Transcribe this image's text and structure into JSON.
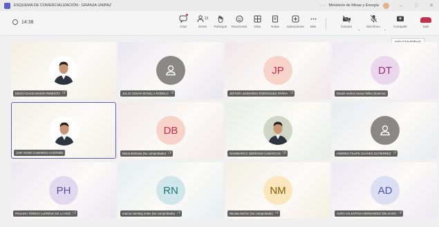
{
  "window": {
    "title": "ESQUEMA DE COMERCIALIZACIÓN - GRANJA UNIPAZ",
    "more": "···",
    "organization": "Ministerio de Minas y Energía",
    "minimize": "–",
    "maximize": "□",
    "close": "✕"
  },
  "toolbar": {
    "timer": "14:38",
    "participants_count": "12",
    "items": [
      {
        "label": "Chat",
        "icon": "chat-icon"
      },
      {
        "label": "Gente",
        "icon": "people-icon"
      },
      {
        "label": "Participar",
        "icon": "raise-hand-icon"
      },
      {
        "label": "Reaccionar",
        "icon": "react-icon"
      },
      {
        "label": "Vista",
        "icon": "view-icon"
      },
      {
        "label": "Notas",
        "icon": "notes-icon"
      },
      {
        "label": "Aplicaciones",
        "icon": "apps-icon"
      },
      {
        "label": "Más",
        "icon": "more-icon"
      },
      {
        "label": "Cámara",
        "icon": "camera-off-icon"
      },
      {
        "label": "Micrófono",
        "icon": "mic-off-icon"
      },
      {
        "label": "Compartir",
        "icon": "share-icon"
      },
      {
        "label": "Salir",
        "icon": "leave-icon"
      }
    ],
    "leave_tooltip": "Salir (Ctrl+Shift+H)"
  },
  "participants": [
    {
      "name": "DIEGO DAVID MARIN PIMIENTO",
      "initials": "",
      "photo": true,
      "bg": "#f4efe2",
      "avatar_bg": "#ffffff",
      "avatar_fg": "#c0392b",
      "muted": true
    },
    {
      "name": "JULIO CESAR BONILLA RODELO",
      "initials": "",
      "photo": false,
      "bg": "#e8e6ef",
      "avatar_bg": "#8a8886",
      "avatar_fg": "#ffffff",
      "muted": true
    },
    {
      "name": "JEFFER LEONARDO RODRIGUEZ PARRA",
      "initials": "JP",
      "photo": false,
      "bg": "#f1e6ea",
      "avatar_bg": "#f7d3c9",
      "avatar_fg": "#c4314b",
      "muted": true
    },
    {
      "name": "Daniel Andres Sossa Tellez (Externo)",
      "initials": "DT",
      "photo": false,
      "bg": "#ede8f2",
      "avatar_bg": "#ead7ed",
      "avatar_fg": "#9b2d7e",
      "muted": false
    },
    {
      "name": "JAIR YESID CAMARGO CASTAÑO",
      "initials": "",
      "photo": true,
      "bg": "#f2f0e6",
      "avatar_bg": "#ffffff",
      "avatar_fg": "#2c2c2c",
      "muted": false
    },
    {
      "name": "Diana Barbosa (No comprobado)",
      "initials": "DB",
      "photo": false,
      "bg": "#f3e8ea",
      "avatar_bg": "#f7d3c9",
      "avatar_fg": "#c4314b",
      "muted": true
    },
    {
      "name": "GIANMARCO SERRANO CABARCAS",
      "initials": "",
      "photo": true,
      "bg": "#e9eee6",
      "avatar_bg": "#cfd8c6",
      "avatar_fg": "#5a6b4a",
      "muted": true
    },
    {
      "name": "ANDRES FELIPE CHAVES GUTIERREZ",
      "initials": "",
      "photo": false,
      "bg": "#e8eaf0",
      "avatar_bg": "#8a8886",
      "avatar_fg": "#ffffff",
      "muted": true
    },
    {
      "name": "PAULINA TERESA LLERENA DE LA HOZ",
      "initials": "PH",
      "photo": false,
      "bg": "#ebe7f1",
      "avatar_bg": "#e1d9ef",
      "avatar_fg": "#5c4a9e",
      "muted": true
    },
    {
      "name": "read.ai meeting notes (No comprobado)",
      "initials": "RN",
      "photo": false,
      "bg": "#e6eef0",
      "avatar_bg": "#cfe7ea",
      "avatar_fg": "#1f6f78",
      "muted": true
    },
    {
      "name": "Nicolas Muñoz (No comprobado)",
      "initials": "NM",
      "photo": false,
      "bg": "#f3efe2",
      "avatar_bg": "#fbe6bd",
      "avatar_fg": "#8a5a00",
      "muted": true
    },
    {
      "name": "AURA VALENTINA HERNANDEZ DELGADO",
      "initials": "AD",
      "photo": false,
      "bg": "#ebe8f3",
      "avatar_bg": "#dcdff3",
      "avatar_fg": "#4f52b2",
      "muted": true
    }
  ],
  "mic_off_glyph": "🎙̸"
}
